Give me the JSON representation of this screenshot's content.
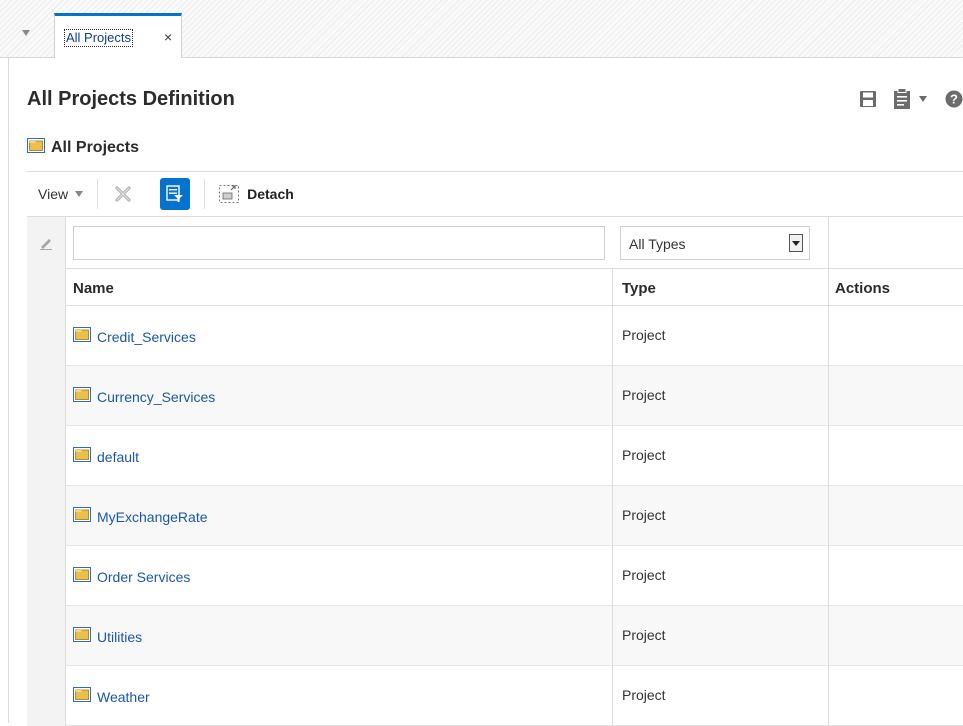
{
  "tab": {
    "label": "All Projects",
    "close": "×"
  },
  "page": {
    "title": "All Projects Definition",
    "section_title": "All Projects"
  },
  "toolbar": {
    "view_label": "View",
    "detach_label": "Detach"
  },
  "filters": {
    "name_value": "",
    "type_selected": "All Types"
  },
  "table": {
    "columns": {
      "name": "Name",
      "type": "Type",
      "actions": "Actions"
    },
    "rows": [
      {
        "name": "Credit_Services",
        "type": "Project"
      },
      {
        "name": "Currency_Services",
        "type": "Project"
      },
      {
        "name": "default",
        "type": "Project"
      },
      {
        "name": "MyExchangeRate",
        "type": "Project"
      },
      {
        "name": "Order Services",
        "type": "Project"
      },
      {
        "name": "Utilities",
        "type": "Project"
      },
      {
        "name": "Weather",
        "type": "Project"
      }
    ]
  },
  "colors": {
    "accent": "#0572ce",
    "link": "#1a57a8",
    "folder": "#e8c04a"
  }
}
